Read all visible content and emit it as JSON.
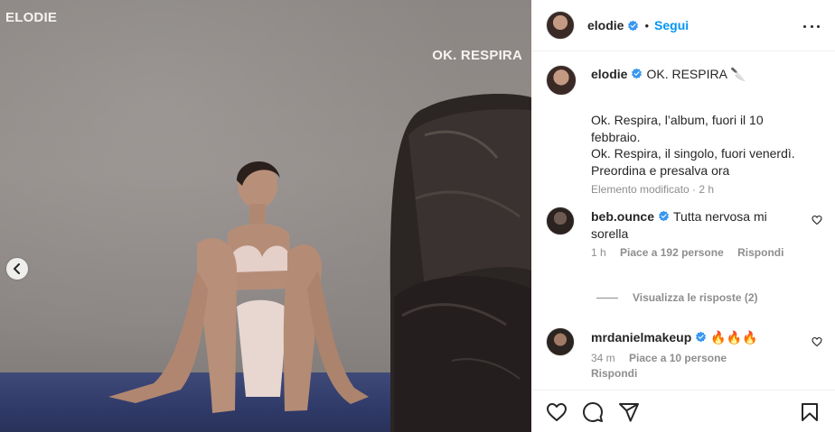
{
  "photo": {
    "overlay_top_left": "ELODIE",
    "overlay_top_right": "OK. RESPIRA"
  },
  "post": {
    "author": "elodie",
    "follow_label": "Segui",
    "separator": "•",
    "caption": {
      "username": "elodie",
      "title": "OK. RESPIRA 🔪",
      "body_lines": [
        "Ok. Respira, l’album, fuori il 10",
        "febbraio.",
        "Ok. Respira, il singolo, fuori venerdì.",
        "Preordina e presalva ora"
      ],
      "meta": "Elemento modificato · 2 h"
    }
  },
  "comments": [
    {
      "username": "beb.ounce",
      "text": "Tutta nervosa mi sorella",
      "time": "1 h",
      "likes": "Piace a 192 persone",
      "reply_label": "Rispondi",
      "view_replies": "Visualizza le risposte (2)"
    },
    {
      "username": "mrdanielmakeup",
      "text": "🔥🔥🔥",
      "time": "34 m",
      "likes": "Piace a 10 persone",
      "reply_label": "Rispondi"
    }
  ],
  "icons": {
    "verified": "verified-badge-icon",
    "more": "more-options-icon",
    "like": "heart-icon",
    "comment": "comment-icon",
    "share": "share-icon",
    "save": "bookmark-icon",
    "prev": "chevron-left-icon"
  },
  "colors": {
    "accent": "#0095f6",
    "verified": "#3897f0",
    "text": "#262626",
    "secondary": "#8e8e8e"
  }
}
